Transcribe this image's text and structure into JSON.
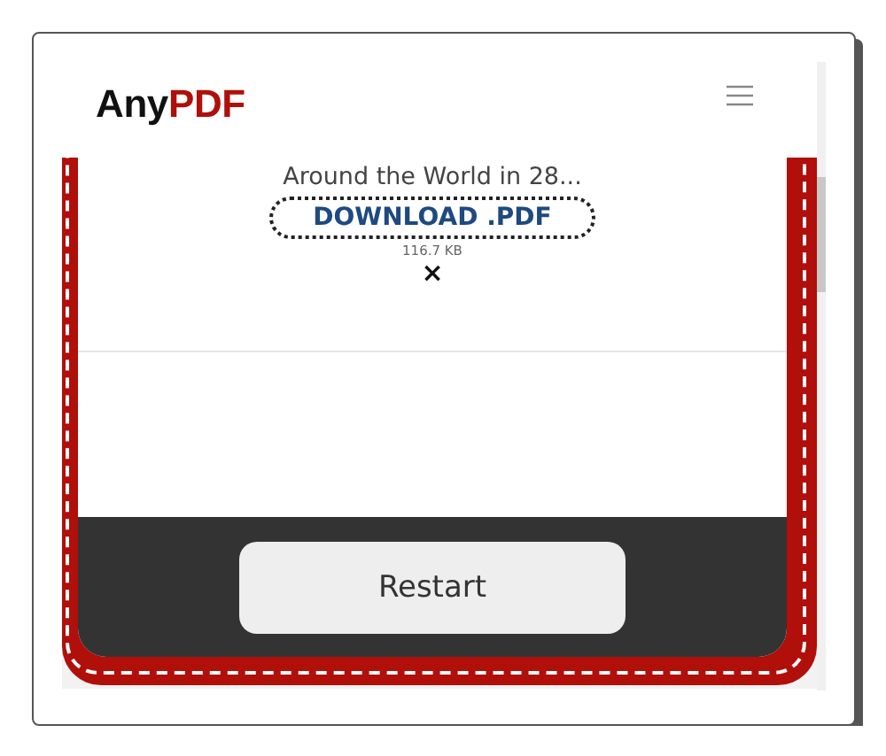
{
  "header": {
    "logo": {
      "text": "Any",
      "accent": "PDF"
    }
  },
  "result": {
    "file_name": "Around the World in 28...",
    "download_label": "DOWNLOAD .PDF",
    "file_size": "116.7 KB",
    "remove_symbol": "×"
  },
  "footer": {
    "restart_label": "Restart"
  }
}
